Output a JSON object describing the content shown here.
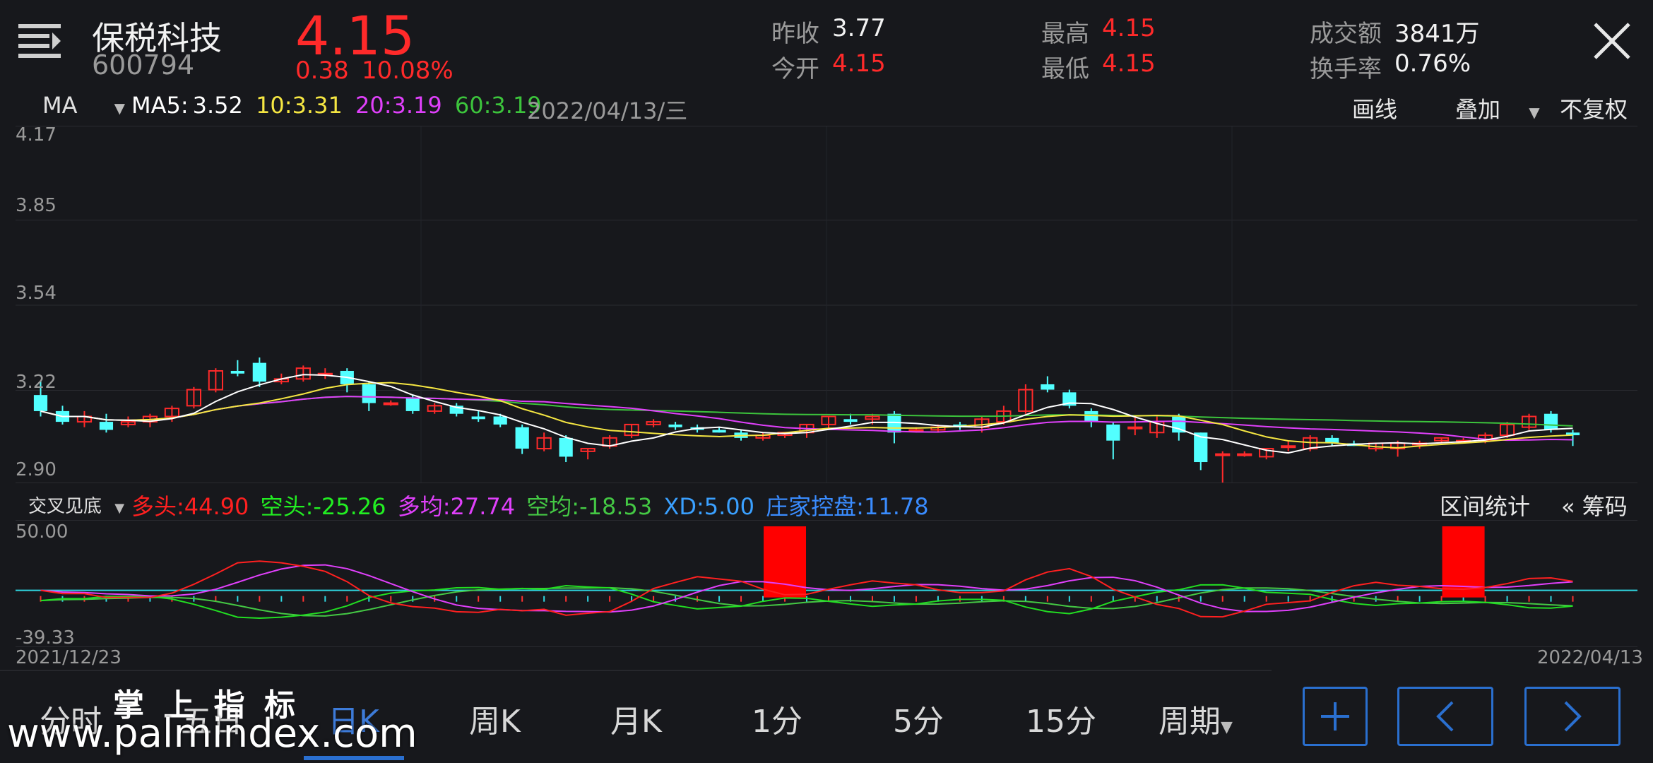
{
  "header": {
    "stock_name": "保税科技",
    "stock_code": "600794",
    "price": "4.15",
    "change": "0.38",
    "change_pct": "10.08%",
    "prev_close_label": "昨收",
    "prev_close": "3.77",
    "open_label": "今开",
    "open": "4.15",
    "high_label": "最高",
    "high": "4.15",
    "low_label": "最低",
    "low": "4.15",
    "turnover_amount_label": "成交额",
    "turnover_amount": "3841万",
    "turnover_rate_label": "换手率",
    "turnover_rate": "0.76%"
  },
  "toolbar": {
    "indicator": "MA",
    "ma5_label": "MA5:",
    "ma5": "3.52",
    "ma10_label": "10:",
    "ma10": "3.31",
    "ma20_label": "20:",
    "ma20": "3.19",
    "ma60_label": "60:",
    "ma60": "3.19",
    "date": "2022/04/13/三",
    "draw_label": "画线",
    "overlay_label": "叠加",
    "adjust_label": "不复权"
  },
  "price_axis": [
    "4.17",
    "3.85",
    "3.54",
    "3.22",
    "2.90"
  ],
  "sub_toolbar": {
    "indicator": "交叉见底",
    "bull_label": "多头:",
    "bull": "44.90",
    "bear_label": "空头:",
    "bear": "-25.26",
    "bull_avg_label": "多均:",
    "bull_avg": "27.74",
    "bear_avg_label": "空均:",
    "bear_avg": "-18.53",
    "xd_label": "XD:",
    "xd": "5.00",
    "dealer_label": "庄家控盘:",
    "dealer": "11.78",
    "range_stats": "区间统计",
    "chips": "« 筹码"
  },
  "sub_axis": {
    "top": "50.00",
    "bottom": "-39.33"
  },
  "dates": {
    "start": "2021/12/23",
    "end": "2022/04/13"
  },
  "tabs": [
    "分时",
    "五日",
    "日K",
    "周K",
    "月K",
    "1分",
    "5分",
    "15分",
    "周期"
  ],
  "active_tab": "日K",
  "watermark": {
    "top": "掌 上 指 标",
    "url": "www.palmindex.com"
  },
  "colors": {
    "up": "#ff2a2a",
    "down": "#52ffff",
    "ma5": "#ffffff",
    "ma10": "#f5e642",
    "ma20": "#e040fb",
    "ma60": "#3cc43c",
    "bull": "#ff2020",
    "bear": "#22dd22",
    "bull_avg": "#e040fb",
    "bear_avg": "#44c844",
    "accent": "#2a6fcf"
  },
  "chart_data": {
    "type": "candlestick",
    "ylim": [
      2.9,
      4.17
    ],
    "candles": [
      [
        3.2,
        3.25,
        3.12,
        3.14
      ],
      [
        3.14,
        3.16,
        3.09,
        3.1
      ],
      [
        3.1,
        3.14,
        3.08,
        3.12
      ],
      [
        3.1,
        3.13,
        3.06,
        3.07
      ],
      [
        3.09,
        3.12,
        3.08,
        3.1
      ],
      [
        3.1,
        3.13,
        3.08,
        3.12
      ],
      [
        3.12,
        3.16,
        3.1,
        3.15
      ],
      [
        3.16,
        3.23,
        3.15,
        3.22
      ],
      [
        3.22,
        3.3,
        3.21,
        3.29
      ],
      [
        3.29,
        3.33,
        3.27,
        3.28
      ],
      [
        3.32,
        3.34,
        3.23,
        3.25
      ],
      [
        3.25,
        3.28,
        3.24,
        3.26
      ],
      [
        3.26,
        3.31,
        3.25,
        3.3
      ],
      [
        3.28,
        3.3,
        3.26,
        3.28
      ],
      [
        3.29,
        3.3,
        3.21,
        3.24
      ],
      [
        3.24,
        3.25,
        3.14,
        3.17
      ],
      [
        3.17,
        3.18,
        3.16,
        3.17
      ],
      [
        3.19,
        3.2,
        3.13,
        3.14
      ],
      [
        3.14,
        3.17,
        3.13,
        3.16
      ],
      [
        3.16,
        3.17,
        3.12,
        3.13
      ],
      [
        3.12,
        3.14,
        3.1,
        3.11
      ],
      [
        3.12,
        3.13,
        3.08,
        3.09
      ],
      [
        3.08,
        3.09,
        2.98,
        3.0
      ],
      [
        3.0,
        3.06,
        2.99,
        3.04
      ],
      [
        3.04,
        3.05,
        2.95,
        2.97
      ],
      [
        2.99,
        3.0,
        2.96,
        3.0
      ],
      [
        3.01,
        3.05,
        3.0,
        3.04
      ],
      [
        3.05,
        3.09,
        3.04,
        3.09
      ],
      [
        3.09,
        3.11,
        3.08,
        3.1
      ],
      [
        3.09,
        3.1,
        3.07,
        3.08
      ],
      [
        3.08,
        3.09,
        3.06,
        3.07
      ],
      [
        3.07,
        3.08,
        3.06,
        3.06
      ],
      [
        3.06,
        3.07,
        3.03,
        3.04
      ],
      [
        3.04,
        3.06,
        3.03,
        3.05
      ],
      [
        3.05,
        3.06,
        3.04,
        3.06
      ],
      [
        3.06,
        3.09,
        3.04,
        3.09
      ],
      [
        3.09,
        3.12,
        3.07,
        3.12
      ],
      [
        3.11,
        3.13,
        3.09,
        3.1
      ],
      [
        3.11,
        3.13,
        3.09,
        3.12
      ],
      [
        3.13,
        3.14,
        3.02,
        3.06
      ],
      [
        3.07,
        3.08,
        3.06,
        3.07
      ],
      [
        3.07,
        3.09,
        3.06,
        3.08
      ],
      [
        3.09,
        3.1,
        3.07,
        3.08
      ],
      [
        3.08,
        3.12,
        3.06,
        3.11
      ],
      [
        3.1,
        3.16,
        3.09,
        3.14
      ],
      [
        3.14,
        3.24,
        3.13,
        3.22
      ],
      [
        3.24,
        3.27,
        3.21,
        3.22
      ],
      [
        3.21,
        3.22,
        3.15,
        3.16
      ],
      [
        3.14,
        3.15,
        3.08,
        3.1
      ],
      [
        3.09,
        3.1,
        2.96,
        3.03
      ],
      [
        3.08,
        3.12,
        3.05,
        3.08
      ],
      [
        3.06,
        3.12,
        3.04,
        3.1
      ],
      [
        3.12,
        3.13,
        3.03,
        3.06
      ],
      [
        3.06,
        3.06,
        2.92,
        2.95
      ],
      [
        2.98,
        2.99,
        2.87,
        2.98
      ],
      [
        2.98,
        2.99,
        2.97,
        2.98
      ],
      [
        2.97,
        3.0,
        2.96,
        3.0
      ],
      [
        3.01,
        3.03,
        2.99,
        3.01
      ],
      [
        3.0,
        3.05,
        2.99,
        3.04
      ],
      [
        3.04,
        3.05,
        3.01,
        3.02
      ],
      [
        3.02,
        3.03,
        3.01,
        3.01
      ],
      [
        3.0,
        3.02,
        2.99,
        3.02
      ],
      [
        3.0,
        3.03,
        2.97,
        3.02
      ],
      [
        3.02,
        3.03,
        3.0,
        3.02
      ],
      [
        3.03,
        3.04,
        3.02,
        3.04
      ],
      [
        3.03,
        3.04,
        3.02,
        3.03
      ],
      [
        3.03,
        3.06,
        3.02,
        3.05
      ],
      [
        3.05,
        3.1,
        3.04,
        3.09
      ],
      [
        3.08,
        3.13,
        3.07,
        3.12
      ],
      [
        3.13,
        3.14,
        3.06,
        3.07
      ],
      [
        3.06,
        3.07,
        3.01,
        3.05
      ]
    ],
    "sub_chart": {
      "ylim": [
        -39.33,
        50.0
      ],
      "signal_bars": [
        34,
        65
      ]
    }
  }
}
